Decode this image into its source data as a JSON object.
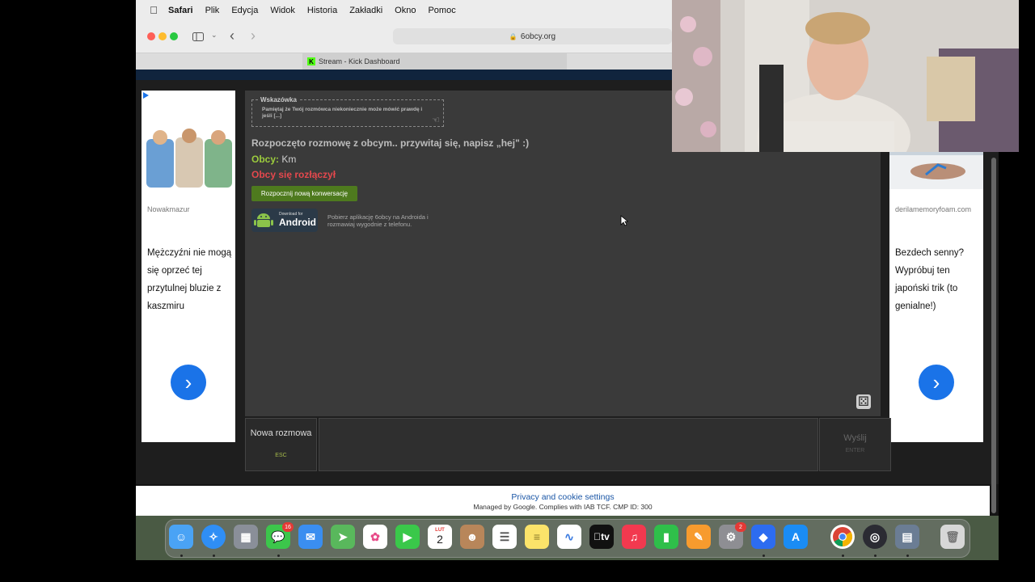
{
  "menubar": {
    "items": [
      "Safari",
      "Plik",
      "Edycja",
      "Widok",
      "Historia",
      "Zakładki",
      "Okno",
      "Pomoc"
    ]
  },
  "browser": {
    "url": "6obcy.org",
    "tab_title": "Stream - Kick Dashboard"
  },
  "ads": {
    "left": {
      "source": "Nowakmazur",
      "text": "Mężczyźni nie mogą się oprzeć tej przytulnej bluzie z kaszmiru",
      "arrow": "›"
    },
    "right": {
      "source": "derilamemoryfoam.com",
      "text": "Bezdech senny? Wypróbuj ten japoński trik (to genialne!)",
      "arrow": "›"
    }
  },
  "chat": {
    "hint_label": "Wskazówka",
    "hint_text": "Pamiętaj że Twój rozmówca niekoniecznie może mówić prawdę i jeśli [...]",
    "started": "Rozpoczęto rozmowę z obcym.. przywitaj się, napisz „hej\" :)",
    "msg_author": "Obcy:",
    "msg_text": "Km",
    "disconnected": "Obcy się rozłączył",
    "new_conversation_button": "Rozpocznij nową konwersację",
    "android_small": "Download for",
    "android_big": "Android",
    "app_info": "Pobierz aplikację 6obcy na Androida i rozmawiaj wygodnie z telefonu."
  },
  "controls": {
    "new_label": "Nowa rozmowa",
    "new_key": "ESC",
    "send_label": "Wyślij",
    "send_key": "ENTER"
  },
  "cookie": {
    "link": "Privacy and cookie settings",
    "note": "Managed by Google. Complies with IAB TCF. CMP ID: 300"
  },
  "dock": {
    "badges": {
      "messages": "16",
      "settings": "2"
    },
    "calendar_month": "LUT",
    "calendar_day": "2",
    "tv_label": "tv"
  },
  "colors": {
    "accent_green": "#4e7a1e",
    "obcy_green": "#9ccc3d",
    "disconnect_red": "#e5484d",
    "ad_button_blue": "#1a73e8"
  }
}
